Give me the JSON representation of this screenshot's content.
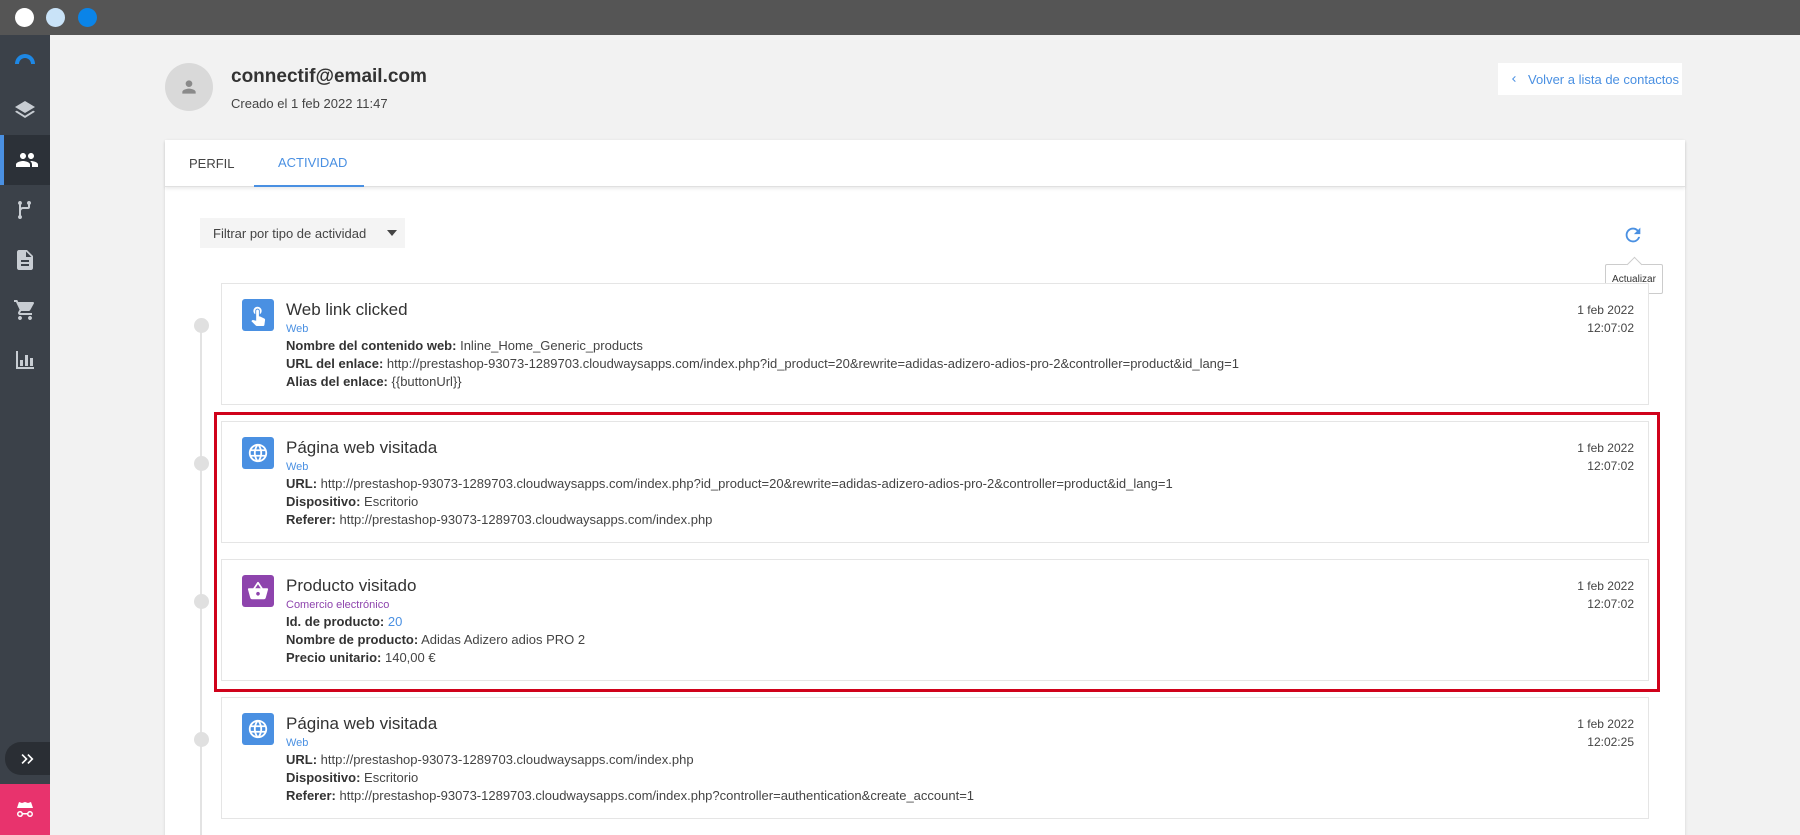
{
  "window": {
    "dots": [
      "close",
      "minimize",
      "maximize"
    ]
  },
  "sidebar": {
    "items": [
      {
        "name": "logo",
        "icon": "rainbow-logo-icon"
      },
      {
        "name": "layers",
        "icon": "layers-icon"
      },
      {
        "name": "contacts",
        "icon": "contacts-icon",
        "active": true
      },
      {
        "name": "workflows",
        "icon": "branch-icon"
      },
      {
        "name": "content",
        "icon": "document-icon"
      },
      {
        "name": "ecommerce",
        "icon": "cart-icon"
      },
      {
        "name": "reports",
        "icon": "bar-chart-icon"
      }
    ],
    "expand_icon": "double-chevron-right-icon",
    "bottom_icon": "incognito-icon"
  },
  "contact": {
    "email": "connectif@email.com",
    "created": "Creado el 1 feb 2022 11:47"
  },
  "back_link": "Volver a lista de contactos",
  "tabs": [
    {
      "label": "PERFIL",
      "active": false
    },
    {
      "label": "ACTIVIDAD",
      "active": true
    }
  ],
  "filter": {
    "label": "Filtrar por tipo de actividad"
  },
  "refresh": {
    "tooltip": "Actualizar"
  },
  "activities": [
    {
      "title": "Web link clicked",
      "category": "Web",
      "icon": "pointer-hand-icon",
      "date": "1 feb 2022",
      "time": "12:07:02",
      "fields": [
        {
          "label": "Nombre del contenido web:",
          "value": "Inline_Home_Generic_products"
        },
        {
          "label": "URL del enlace:",
          "value": "http://prestashop-93073-1289703.cloudwaysapps.com/index.php?id_product=20&rewrite=adidas-adizero-adios-pro-2&controller=product&id_lang=1"
        },
        {
          "label": "Alias del enlace:",
          "value": "{{buttonUrl}}"
        }
      ]
    },
    {
      "title": "Página web visitada",
      "category": "Web",
      "icon": "globe-icon",
      "date": "1 feb 2022",
      "time": "12:07:02",
      "fields": [
        {
          "label": "URL:",
          "value": "http://prestashop-93073-1289703.cloudwaysapps.com/index.php?id_product=20&rewrite=adidas-adizero-adios-pro-2&controller=product&id_lang=1"
        },
        {
          "label": "Dispositivo:",
          "value": "Escritorio"
        },
        {
          "label": "Referer:",
          "value": "http://prestashop-93073-1289703.cloudwaysapps.com/index.php"
        }
      ]
    },
    {
      "title": "Producto visitado",
      "category": "Comercio electrónico",
      "icon": "basket-icon",
      "date": "1 feb 2022",
      "time": "12:07:02",
      "fields": [
        {
          "label": "Id. de producto:",
          "value": "20"
        },
        {
          "label": "Nombre de producto:",
          "value": "Adidas Adizero adios PRO 2"
        },
        {
          "label": "Precio unitario:",
          "value": "140,00 €"
        }
      ]
    },
    {
      "title": "Página web visitada",
      "category": "Web",
      "icon": "globe-icon",
      "date": "1 feb 2022",
      "time": "12:02:25",
      "fields": [
        {
          "label": "URL:",
          "value": "http://prestashop-93073-1289703.cloudwaysapps.com/index.php"
        },
        {
          "label": "Dispositivo:",
          "value": "Escritorio"
        },
        {
          "label": "Referer:",
          "value": "http://prestashop-93073-1289703.cloudwaysapps.com/index.php?controller=authentication&create_account=1"
        }
      ]
    }
  ],
  "colors": {
    "accent": "#4a90e2",
    "ecommerce": "#8e44ad",
    "highlight": "#d0021b",
    "sidebar": "#3b4149"
  }
}
